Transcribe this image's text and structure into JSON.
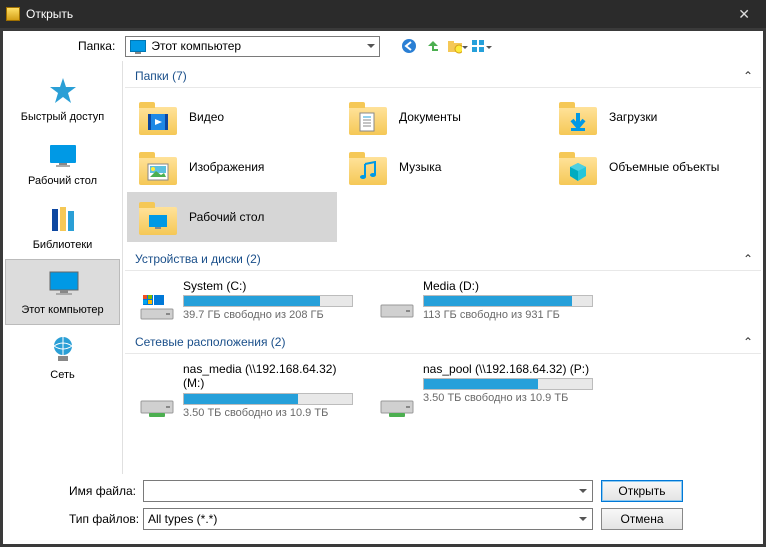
{
  "window": {
    "title": "Открыть",
    "close_glyph": "✕"
  },
  "toolbar": {
    "folder_label": "Папка:",
    "current_folder": "Этот компьютер",
    "buttons": {
      "back": "back-icon",
      "up": "up-icon",
      "new_folder": "new-folder-icon",
      "view": "view-icon"
    }
  },
  "sidebar": {
    "items": [
      {
        "id": "quick",
        "label": "Быстрый доступ",
        "active": false
      },
      {
        "id": "desktop",
        "label": "Рабочий стол",
        "active": false
      },
      {
        "id": "libraries",
        "label": "Библиотеки",
        "active": false
      },
      {
        "id": "pc",
        "label": "Этот компьютер",
        "active": true
      },
      {
        "id": "network",
        "label": "Сеть",
        "active": false
      }
    ]
  },
  "sections": {
    "folders": {
      "title": "Папки (7)",
      "items": [
        {
          "label": "Видео",
          "icon": "video"
        },
        {
          "label": "Документы",
          "icon": "documents"
        },
        {
          "label": "Загрузки",
          "icon": "downloads"
        },
        {
          "label": "Изображения",
          "icon": "pictures"
        },
        {
          "label": "Музыка",
          "icon": "music"
        },
        {
          "label": "Объемные объекты",
          "icon": "3d"
        },
        {
          "label": "Рабочий стол",
          "icon": "desktop",
          "selected": true
        }
      ]
    },
    "drives": {
      "title": "Устройства и диски (2)",
      "items": [
        {
          "name": "System (C:)",
          "free_text": "39.7 ГБ свободно из 208 ГБ",
          "fill_pct": 81,
          "type": "system"
        },
        {
          "name": "Media (D:)",
          "free_text": "113 ГБ свободно из 931 ГБ",
          "fill_pct": 88,
          "type": "hdd"
        }
      ]
    },
    "network": {
      "title": "Сетевые расположения (2)",
      "items": [
        {
          "name": "nas_media (\\\\192.168.64.32) (M:)",
          "free_text": "3.50 ТБ свободно из 10.9 ТБ",
          "fill_pct": 68
        },
        {
          "name": "nas_pool (\\\\192.168.64.32) (P:)",
          "free_text": "3.50 ТБ свободно из 10.9 ТБ",
          "fill_pct": 68
        }
      ]
    }
  },
  "bottom": {
    "filename_label": "Имя файла:",
    "filename_value": "",
    "filetype_label": "Тип файлов:",
    "filetype_value": "All types (*.*)",
    "open_label": "Открыть",
    "cancel_label": "Отмена"
  }
}
